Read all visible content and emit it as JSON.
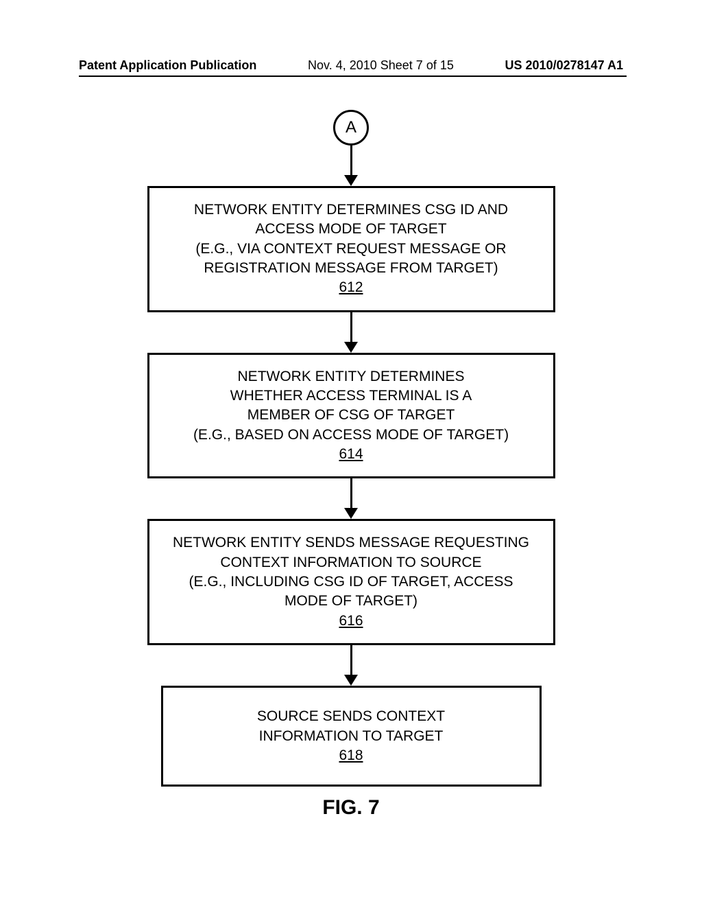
{
  "header": {
    "left": "Patent Application Publication",
    "center": "Nov. 4, 2010  Sheet 7 of 15",
    "right": "US 2010/0278147 A1"
  },
  "connector": "A",
  "steps": [
    {
      "lines": [
        "NETWORK ENTITY DETERMINES CSG ID AND",
        "ACCESS MODE OF TARGET",
        "(E.G., VIA CONTEXT REQUEST MESSAGE OR",
        "REGISTRATION MESSAGE FROM TARGET)"
      ],
      "num": "612"
    },
    {
      "lines": [
        "NETWORK ENTITY DETERMINES",
        "WHETHER ACCESS TERMINAL IS A",
        "MEMBER OF CSG OF TARGET",
        "(E.G., BASED ON ACCESS MODE OF TARGET)"
      ],
      "num": "614"
    },
    {
      "lines": [
        "NETWORK ENTITY SENDS MESSAGE REQUESTING",
        "CONTEXT INFORMATION TO SOURCE",
        "(E.G., INCLUDING CSG ID OF TARGET, ACCESS",
        "MODE OF TARGET)"
      ],
      "num": "616"
    },
    {
      "lines": [
        "SOURCE SENDS CONTEXT",
        "INFORMATION TO TARGET"
      ],
      "num": "618"
    }
  ],
  "figure_label": "FIG. 7"
}
